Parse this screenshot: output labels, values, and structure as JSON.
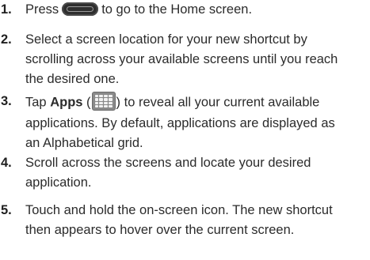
{
  "steps": [
    {
      "number": "1.",
      "before": "Press",
      "icon": "home-key-icon",
      "after": "to go to the Home screen."
    },
    {
      "number": "2.",
      "lines": [
        "Select a screen location for your new shortcut by",
        "scrolling across your available screens until you reach",
        "the desired one."
      ]
    },
    {
      "number": "3.",
      "tap": "Tap",
      "apps_label": "Apps",
      "paren_open": "(",
      "icon": "apps-grid-icon",
      "paren_close_rest": ") to reveal all your current available",
      "lines": [
        "applications. By default, applications are displayed as",
        "an Alphabetical grid."
      ]
    },
    {
      "number": "4.",
      "lines": [
        "Scroll across the screens and locate your desired",
        "application."
      ]
    },
    {
      "number": "5.",
      "lines": [
        "Touch and hold the on-screen icon. The new shortcut",
        "then appears to hover over the current screen."
      ]
    }
  ]
}
